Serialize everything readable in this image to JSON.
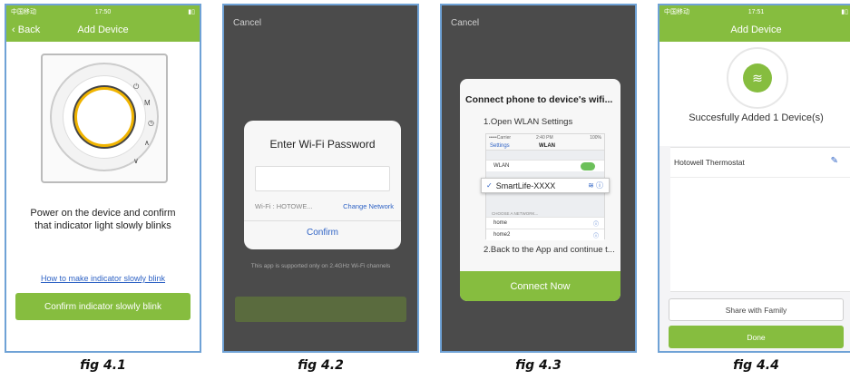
{
  "colors": {
    "accent": "#86bd3f",
    "link": "#2f63c5",
    "frame": "#6fa2d6"
  },
  "fig1": {
    "status": {
      "carrier": "中国移动",
      "time": "17:50"
    },
    "back_label": "Back",
    "title": "Add Device",
    "instruction_line1": "Power on the device and confirm",
    "instruction_line2": "that indicator light slowly blinks",
    "help_link": "How to make indicator slowly blink",
    "confirm_button": "Confirm indicator slowly blink",
    "caption": "fig 4.1"
  },
  "fig2": {
    "cancel": "Cancel",
    "dialog_title": "Enter Wi-Fi Password",
    "password_value": "",
    "wifi_label": "Wi-Fi : HOTOWE...",
    "change_network": "Change Network",
    "confirm": "Confirm",
    "note": "This app is supported only on 2.4GHz Wi-Fi channels",
    "caption": "fig 4.2"
  },
  "fig3": {
    "cancel": "Cancel",
    "dialog_title": "Connect phone to device's wifi...",
    "step1": "1.Open WLAN Settings",
    "screenshot": {
      "status_left": "•••••Carrier",
      "status_time": "2:40 PM",
      "status_right": "100%",
      "settings": "Settings",
      "wlan_title": "WLAN",
      "wlan_row": "WLAN",
      "selected_network": "SmartLife-XXXX",
      "section": "CHOOSE A NETWORK...",
      "networks": [
        "home",
        "home2"
      ]
    },
    "step2": "2.Back to the App and continue t...",
    "connect_button": "Connect Now",
    "caption": "fig 4.3"
  },
  "fig4": {
    "status": {
      "carrier": "中国移动",
      "time": "17:51"
    },
    "title": "Add Device",
    "success": "Succesfully Added 1 Device(s)",
    "device_name": "Hotowell Thermostat",
    "share_button": "Share with Family",
    "done_button": "Done",
    "caption": "fig 4.4"
  }
}
